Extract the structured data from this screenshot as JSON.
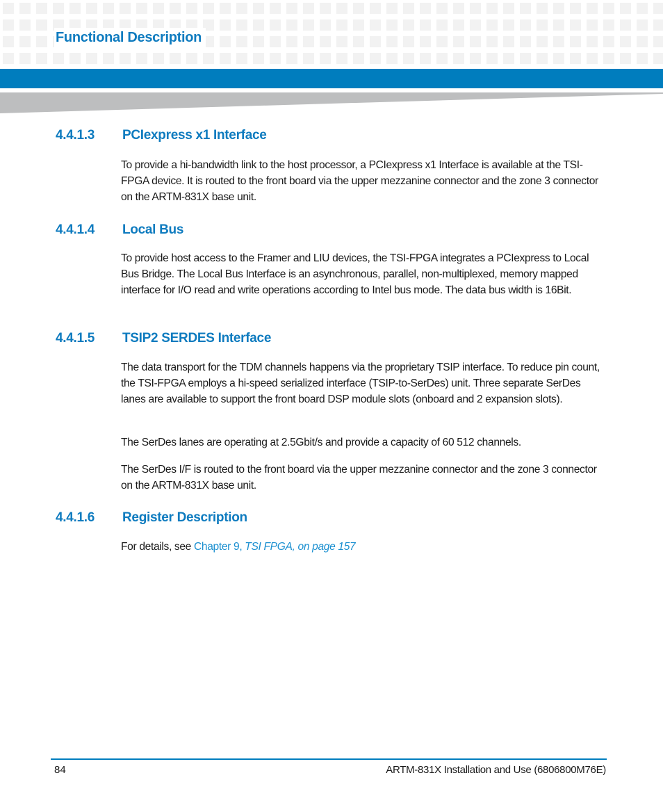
{
  "header": {
    "chapter_title": "Functional Description"
  },
  "sections": [
    {
      "number": "4.4.1.3",
      "title": "PCIexpress x1 Interface",
      "paragraphs": [
        "To provide a hi-bandwidth link to the host processor, a PCIexpress x1 Interface is available at the TSI-FPGA device. It is routed to the front board via the upper mezzanine connector and the zone 3 connector on the ARTM-831X base unit."
      ]
    },
    {
      "number": "4.4.1.4",
      "title": "Local Bus",
      "paragraphs": [
        "To provide host access to the Framer and LIU devices, the TSI-FPGA integrates a PCIexpress to Local Bus Bridge. The Local Bus Interface is an asynchronous, parallel, non-multiplexed, memory mapped interface for I/O read and write operations according to Intel bus mode. The data bus width is 16Bit."
      ]
    },
    {
      "number": "4.4.1.5",
      "title": "TSIP2 SERDES Interface",
      "paragraphs": [
        "The data transport for the TDM channels happens via the proprietary TSIP interface. To reduce pin count, the TSI-FPGA employs a hi-speed serialized interface (TSIP-to-SerDes) unit. Three separate SerDes lanes are available to support the front board DSP module slots (onboard and 2 expansion slots).",
        "The SerDes lanes are operating at 2.5Gbit/s and provide a capacity of 60 512 channels.",
        "The SerDes I/F is routed to the front board via the upper mezzanine connector and the zone 3 connector on the ARTM-831X base unit."
      ]
    },
    {
      "number": "4.4.1.6",
      "title": "Register Description",
      "details_prefix": "For details, see ",
      "link_chapter": "Chapter 9, ",
      "link_title": "TSI FPGA, on page 157"
    }
  ],
  "footer": {
    "page_number": "84",
    "document_title": "ARTM-831X Installation and Use (6806800M76E)"
  },
  "colors": {
    "accent_blue": "#007dbe",
    "heading_blue": "#0e7bbf",
    "link_blue": "#1a8fd0"
  }
}
